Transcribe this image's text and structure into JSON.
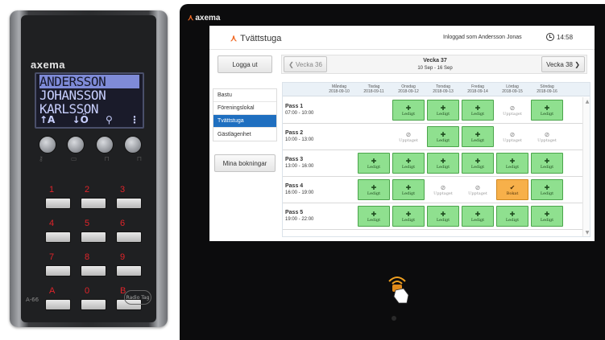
{
  "keypad": {
    "brand": "axema",
    "display_lines": [
      "ANDERSSON",
      "JOHANSSON",
      "KARLSSON"
    ],
    "display_footer": [
      "↑A",
      "↓Ö",
      "⚲",
      "⋮"
    ],
    "round_button_icons": [
      "key-icon",
      "card-icon",
      "lock-open-icon",
      "lock-icon"
    ],
    "keys": [
      {
        "label": "1"
      },
      {
        "label": "2"
      },
      {
        "label": "3"
      },
      {
        "label": "4"
      },
      {
        "label": "5"
      },
      {
        "label": "6"
      },
      {
        "label": "7"
      },
      {
        "label": "8"
      },
      {
        "label": "9"
      },
      {
        "label": "A"
      },
      {
        "label": "0"
      },
      {
        "label": "B"
      }
    ],
    "model": "A-66",
    "nfc_badge": "Radio Tag"
  },
  "tablet": {
    "brand": "axema",
    "app_title": "Tvättstuga",
    "logged_in_text": "Inloggad som Andersson Jonas",
    "clock": "14:58",
    "logout_button": "Logga ut",
    "prev_week_button": "Vecka 36",
    "next_week_button": "Vecka 38",
    "current_week": "Vecka 37",
    "date_range": "10 Sep - 16 Sep",
    "menu": [
      {
        "label": "Bastu",
        "active": false
      },
      {
        "label": "Föreningslokal",
        "active": false
      },
      {
        "label": "Tvättstuga",
        "active": true
      },
      {
        "label": "Gästlägenhet",
        "active": false
      }
    ],
    "my_bookings_button": "Mina bokningar",
    "days": [
      {
        "name": "Måndag",
        "date": "2018-09-10"
      },
      {
        "name": "Tisdag",
        "date": "2018-09-11"
      },
      {
        "name": "Onsdag",
        "date": "2018-09-12"
      },
      {
        "name": "Torsdag",
        "date": "2018-09-13"
      },
      {
        "name": "Fredag",
        "date": "2018-09-14"
      },
      {
        "name": "Lördag",
        "date": "2018-09-15"
      },
      {
        "name": "Söndag",
        "date": "2018-09-16"
      }
    ],
    "status_labels": {
      "ledigt": "Ledigt",
      "upptaget": "Upptaget",
      "bokat": "Bokat"
    },
    "status_icons": {
      "ledigt": "plus-circle-icon",
      "upptaget": "blocked-icon",
      "bokat": "checkmark-icon"
    },
    "colors": {
      "ledigt": "#8fe08f",
      "bokat": "#f7b04a",
      "active_menu": "#1f6fc0",
      "brand_orange": "#f06a25"
    },
    "passes": [
      {
        "name": "Pass 1",
        "time": "07:00 - 10:00",
        "slots": [
          null,
          null,
          "ledigt",
          "ledigt",
          "ledigt",
          "upptaget",
          "ledigt"
        ]
      },
      {
        "name": "Pass 2",
        "time": "10:00 - 13:00",
        "slots": [
          null,
          null,
          "upptaget",
          "ledigt",
          "ledigt",
          "upptaget",
          "upptaget"
        ]
      },
      {
        "name": "Pass 3",
        "time": "13:00 - 16:00",
        "slots": [
          null,
          "ledigt",
          "ledigt",
          "ledigt",
          "ledigt",
          "ledigt",
          "ledigt"
        ]
      },
      {
        "name": "Pass 4",
        "time": "16:00 - 19:00",
        "slots": [
          null,
          "ledigt",
          "ledigt",
          "upptaget",
          "upptaget",
          "bokat",
          "ledigt"
        ]
      },
      {
        "name": "Pass 5",
        "time": "19:00 - 22:00",
        "slots": [
          null,
          "ledigt",
          "ledigt",
          "ledigt",
          "ledigt",
          "ledigt",
          "ledigt"
        ]
      }
    ]
  }
}
